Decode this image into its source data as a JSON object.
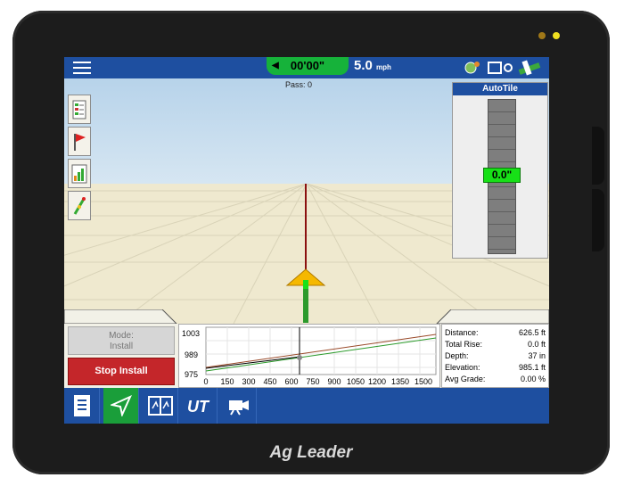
{
  "device": {
    "brand": "Ag Leader"
  },
  "topbar": {
    "timer": "00'00\"",
    "speed_value": "5.0",
    "speed_unit": "mph",
    "pass_label": "Pass: 0"
  },
  "left_tools": [
    "field-info-icon",
    "flag-icon",
    "yield-chart-icon",
    "guidance-line-icon"
  ],
  "autotile": {
    "title": "AutoTile",
    "value": "0.0\""
  },
  "controls": {
    "mode_label": "Mode:",
    "mode_value": "Install",
    "stop_label": "Stop Install"
  },
  "profile_chart": {
    "y_ticks": [
      "1003",
      "989",
      "975"
    ],
    "x_ticks": [
      "0",
      "150",
      "300",
      "450",
      "600",
      "750",
      "900",
      "1050",
      "1200",
      "1350",
      "1500"
    ]
  },
  "stats": [
    {
      "label": "Distance:",
      "value": "626.5 ft"
    },
    {
      "label": "Total Rise:",
      "value": "0.0 ft"
    },
    {
      "label": "Depth:",
      "value": "37 in"
    },
    {
      "label": "Elevation:",
      "value": "985.1 ft"
    },
    {
      "label": "Avg Grade:",
      "value": "0.00 %"
    }
  ],
  "navbar": [
    "document-icon",
    "guidance-icon",
    "split-view-icon",
    "ut-icon",
    "camera-icon"
  ],
  "colors": {
    "topbar": "#1e4fa0",
    "accent_green": "#16b23a",
    "stop_red": "#c4262a"
  }
}
